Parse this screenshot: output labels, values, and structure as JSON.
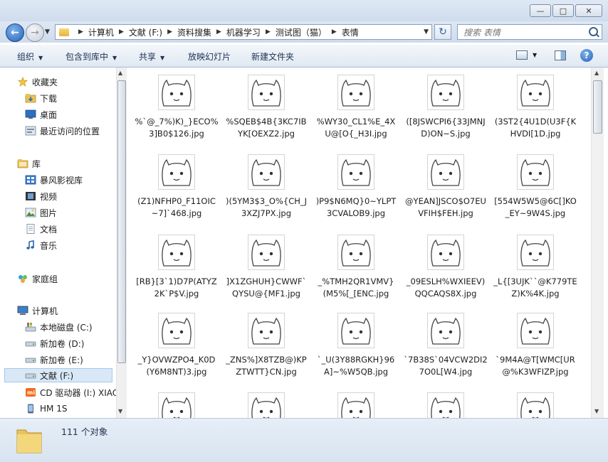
{
  "window": {
    "min": "—",
    "max": "□",
    "close": "✕"
  },
  "address": {
    "crumbs": [
      "计算机",
      "文献 (F:)",
      "资料搜集",
      "机器学习",
      "测试图（猫）",
      "表情"
    ]
  },
  "search": {
    "placeholder": "搜索 表情"
  },
  "toolbar": {
    "organize": "组织",
    "include": "包含到库中",
    "share": "共享",
    "slideshow": "放映幻灯片",
    "newfolder": "新建文件夹"
  },
  "nav": {
    "favorites": "收藏夹",
    "downloads": "下载",
    "desktop": "桌面",
    "recent": "最近访问的位置",
    "libraries": "库",
    "baofeng": "暴风影视库",
    "videos": "视频",
    "pictures": "图片",
    "documents": "文档",
    "music": "音乐",
    "homegroup": "家庭组",
    "computer": "计算机",
    "drive_c": "本地磁盘 (C:)",
    "drive_d": "新加卷 (D:)",
    "drive_e": "新加卷 (E:)",
    "drive_f": "文献 (F:)",
    "drive_i": "CD 驱动器 (I:) XIAOMI",
    "hm1s": "HM 1S"
  },
  "files": [
    "%`@_7%)K)_}ECO%3]B0$126.jpg",
    "%SQEB$4B{3KC7IBYK[OEXZ2.jpg",
    "%WY30_CL1%E_4XU@[O{_H3I.jpg",
    "([8JSWCPI6{33JMNJD)ON~S.jpg",
    "(3ST2{4U1D(U3F{KHVDI[1D.jpg",
    "(Z1)NFHP0_F11OIC~7]`468.jpg",
    ")(5YM3$3_O%{CH_J3XZJ7PX.jpg",
    ")P9$N6MQ}0~YLPT3CVALOB9.jpg",
    "@YEAN]JSCO$O7EUVFIH$FEH.jpg",
    "[554W5W5@6C[]KO_EY~9W4S.jpg",
    "[RB}[3`1)D7P(ATYZ2K`P$V.jpg",
    "]X1ZGHUH}CWWF`QYSU@{MF1.jpg",
    "_%TMH2QR1VMV}(M5%[_[ENC.jpg",
    "_09ESLH%WXIEEV)QQCAQS8X.jpg",
    "_L{[3UJK``@K779TEZ)K%4K.jpg",
    "_Y}OVWZPO4_K0D(Y6M8NT)3.jpg",
    "_ZNS%]X8TZB@)KPZTWTT}CN.jpg",
    "`_U(3Y88RGKH}96A]~%W5QB.jpg",
    "`7B38S`04VCW2DI27O0L[W4.jpg",
    "`9M4A@T[WMC[UR@%K3WFIZP.jpg"
  ],
  "status": {
    "count": "111 个对象"
  }
}
